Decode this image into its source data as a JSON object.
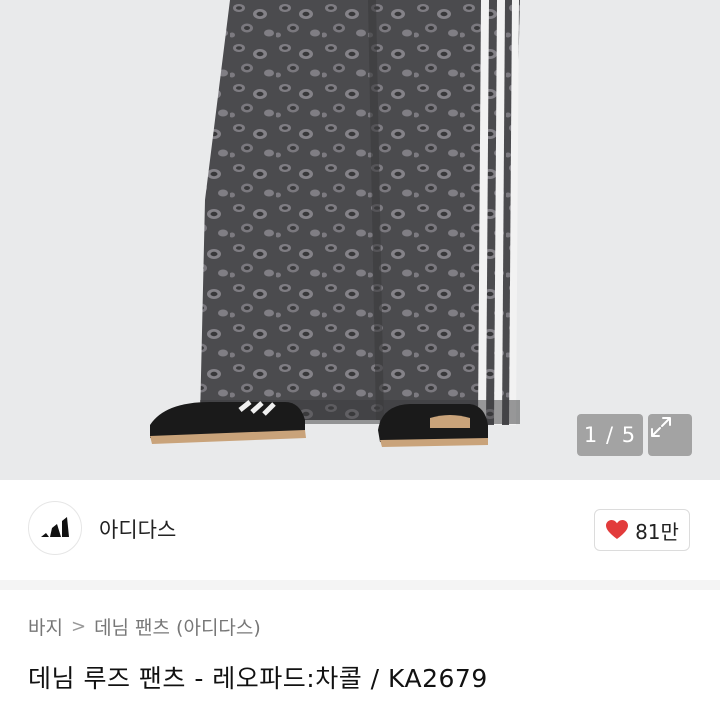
{
  "gallery": {
    "counter": "1 / 5",
    "expand_icon": "expand-icon",
    "image_subject": "product-photo-leopard-print-pants",
    "colors": {
      "background": "#e9eaeb",
      "pants": "#4a4a4c",
      "stripe": "#f2f2f2"
    }
  },
  "brand": {
    "logo_icon": "adidas-logo",
    "name": "아디다스",
    "like_icon": "heart-icon",
    "like_count": "81만",
    "heart_color": "#e23b3b"
  },
  "breadcrumb": {
    "items": [
      "바지",
      "데님 팬츠 (아디다스)"
    ],
    "separator": ">"
  },
  "product": {
    "title": "데님 루즈 팬츠 - 레오파드:차콜 / KA2679"
  }
}
